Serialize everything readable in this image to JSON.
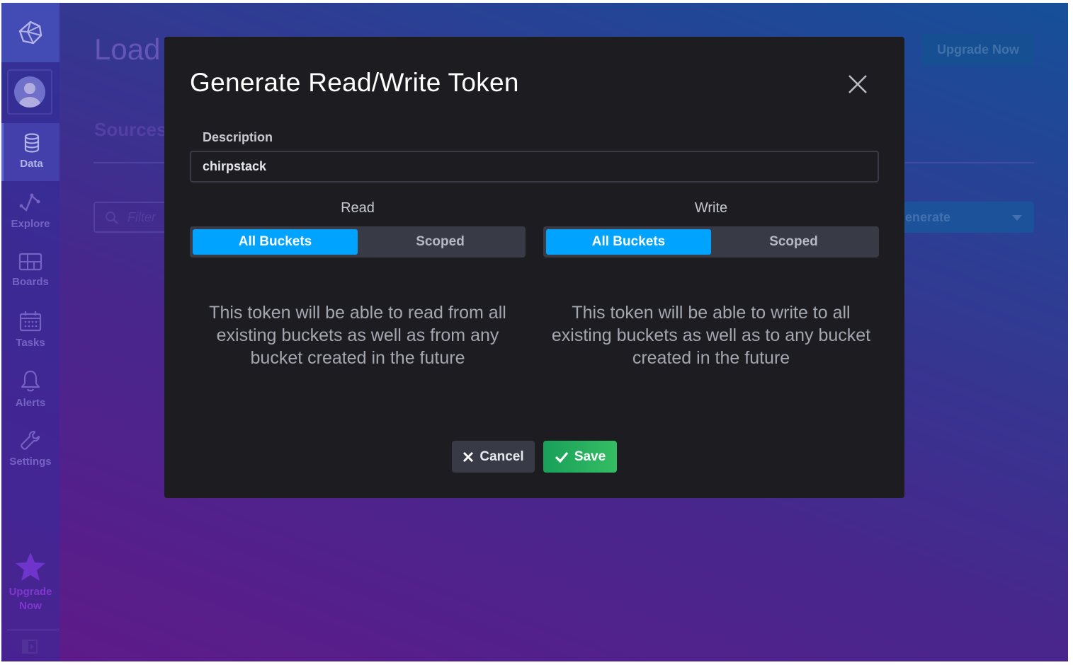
{
  "sidebar": {
    "items": [
      {
        "label": "Data",
        "icon": "database-icon",
        "active": true
      },
      {
        "label": "Explore",
        "icon": "graph-icon",
        "active": false
      },
      {
        "label": "Boards",
        "icon": "dashboard-icon",
        "active": false
      },
      {
        "label": "Tasks",
        "icon": "calendar-icon",
        "active": false
      },
      {
        "label": "Alerts",
        "icon": "bell-icon",
        "active": false
      },
      {
        "label": "Settings",
        "icon": "wrench-icon",
        "active": false
      }
    ],
    "upgrade_line1": "Upgrade",
    "upgrade_line2": "Now"
  },
  "page": {
    "title": "Load",
    "tab": "Sources",
    "filter_placeholder": "Filter",
    "generate_label": "enerate",
    "upgrade_button": "Upgrade Now"
  },
  "modal": {
    "title": "Generate Read/Write Token",
    "description_label": "Description",
    "description_value": "chirpstack",
    "read": {
      "label": "Read",
      "options": [
        "All Buckets",
        "Scoped"
      ],
      "selected": "All Buckets",
      "help": "This token will be able to read from all existing buckets as well as from any bucket created in the future"
    },
    "write": {
      "label": "Write",
      "options": [
        "All Buckets",
        "Scoped"
      ],
      "selected": "All Buckets",
      "help": "This token will be able to write to all existing buckets as well as to any bucket created in the future"
    },
    "cancel_label": "Cancel",
    "save_label": "Save"
  },
  "colors": {
    "accent": "#00a3ff",
    "save_green": "#22a85b",
    "modal_bg": "#1c1c21"
  }
}
